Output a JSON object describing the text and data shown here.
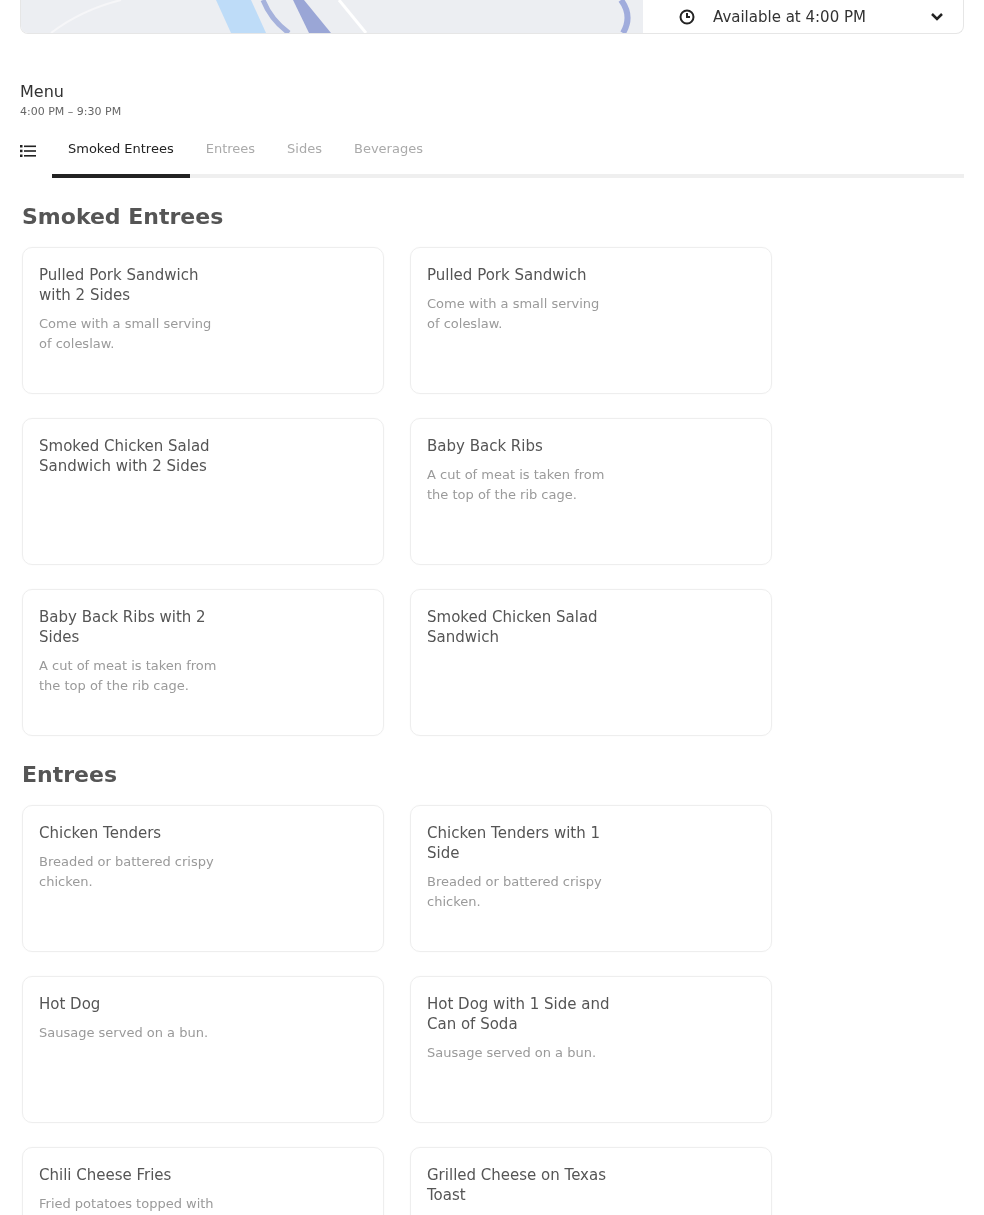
{
  "store_header": {
    "availability": "Available at 4:00 PM"
  },
  "menu": {
    "title": "Menu",
    "hours": "4:00 PM – 9:30 PM"
  },
  "tabs": [
    {
      "label": "Smoked Entrees",
      "selected": true
    },
    {
      "label": "Entrees",
      "selected": false
    },
    {
      "label": "Sides",
      "selected": false
    },
    {
      "label": "Beverages",
      "selected": false
    }
  ],
  "sections": [
    {
      "title": "Smoked Entrees",
      "items": [
        {
          "name": "Pulled Pork Sandwich with 2 Sides",
          "description": "Come with a small serving of coleslaw."
        },
        {
          "name": "Pulled Pork Sandwich",
          "description": "Come with a small serving of coleslaw."
        },
        {
          "name": "Smoked Chicken Salad Sandwich with 2 Sides"
        },
        {
          "name": "Baby Back Ribs",
          "description": "A cut of meat is taken from the top of the rib cage."
        },
        {
          "name": "Baby Back Ribs with 2 Sides",
          "description": "A cut of meat is taken from the top of the rib cage."
        },
        {
          "name": "Smoked Chicken Salad Sandwich"
        }
      ]
    },
    {
      "title": "Entrees",
      "items": [
        {
          "name": "Chicken Tenders",
          "description": "Breaded or battered crispy chicken."
        },
        {
          "name": "Chicken Tenders with 1 Side",
          "description": "Breaded or battered crispy chicken."
        },
        {
          "name": "Hot Dog",
          "description": "Sausage served on a bun."
        },
        {
          "name": "Hot Dog with 1 Side and Can of Soda",
          "description": "Sausage served on a bun."
        },
        {
          "name": "Chili Cheese Fries",
          "description": "Fried potatoes topped with"
        },
        {
          "name": "Grilled Cheese on Texas Toast"
        }
      ]
    }
  ]
}
